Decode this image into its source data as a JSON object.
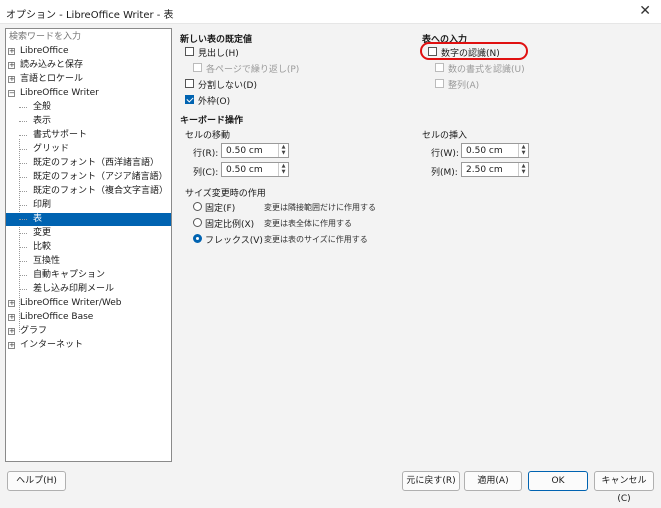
{
  "window": {
    "title": "オプション - LibreOffice Writer - 表",
    "close_glyph": "✕"
  },
  "search": {
    "placeholder": "検索ワードを入力"
  },
  "tree": {
    "items": [
      {
        "label": "LibreOffice",
        "expander": "+"
      },
      {
        "label": "読み込みと保存",
        "expander": "+"
      },
      {
        "label": "言語とロケール",
        "expander": "+"
      },
      {
        "label": "LibreOffice Writer",
        "expander": "−"
      },
      {
        "label": "全般"
      },
      {
        "label": "表示"
      },
      {
        "label": "書式サポート"
      },
      {
        "label": "グリッド"
      },
      {
        "label": "既定のフォント（西洋諸言語）"
      },
      {
        "label": "既定のフォント（アジア諸言語）"
      },
      {
        "label": "既定のフォント（複合文字言語）"
      },
      {
        "label": "印刷"
      },
      {
        "label": "表"
      },
      {
        "label": "変更"
      },
      {
        "label": "比較"
      },
      {
        "label": "互換性"
      },
      {
        "label": "自動キャプション"
      },
      {
        "label": "差し込み印刷メール"
      },
      {
        "label": "LibreOffice Writer/Web",
        "expander": "+"
      },
      {
        "label": "LibreOffice Base",
        "expander": "+"
      },
      {
        "label": "グラフ",
        "expander": "+"
      },
      {
        "label": "インターネット",
        "expander": "+"
      }
    ]
  },
  "defaults": {
    "heading": "新しい表の既定値",
    "heading_label": "見出し(H)",
    "repeat_label": "各ページで繰り返し(P)",
    "dont_split_label": "分割しない(D)",
    "border_label": "外枠(O)"
  },
  "input": {
    "heading": "表への入力",
    "number_recognition_label": "数字の認識(N)",
    "number_format_label": "数の書式を認識(U)",
    "alignment_label": "整列(A)"
  },
  "keyboard": {
    "heading": "キーボード操作",
    "move_heading": "セルの移動",
    "move_row_label": "行(R):",
    "move_row_value": "0.50 cm",
    "move_col_label": "列(C):",
    "move_col_value": "0.50 cm",
    "insert_heading": "セルの挿入",
    "insert_row_label": "行(W):",
    "insert_row_value": "0.50 cm",
    "insert_col_label": "列(M):",
    "insert_col_value": "2.50 cm",
    "resize_heading": "サイズ変更時の作用",
    "fixed_label": "固定(F)",
    "fixed_desc": "変更は隣接範囲だけに作用する",
    "fixed_prop_label": "固定比例(X)",
    "fixed_prop_desc": "変更は表全体に作用する",
    "flex_label": "フレックス(V)",
    "flex_desc": "変更は表のサイズに作用する"
  },
  "buttons": {
    "help": "ヘルプ(H)",
    "reset": "元に戻す(R)",
    "apply": "適用(A)",
    "ok": "OK",
    "cancel": "キャンセル(C)"
  },
  "colors": {
    "accent": "#0063b1",
    "highlight_ring": "#e01010"
  }
}
